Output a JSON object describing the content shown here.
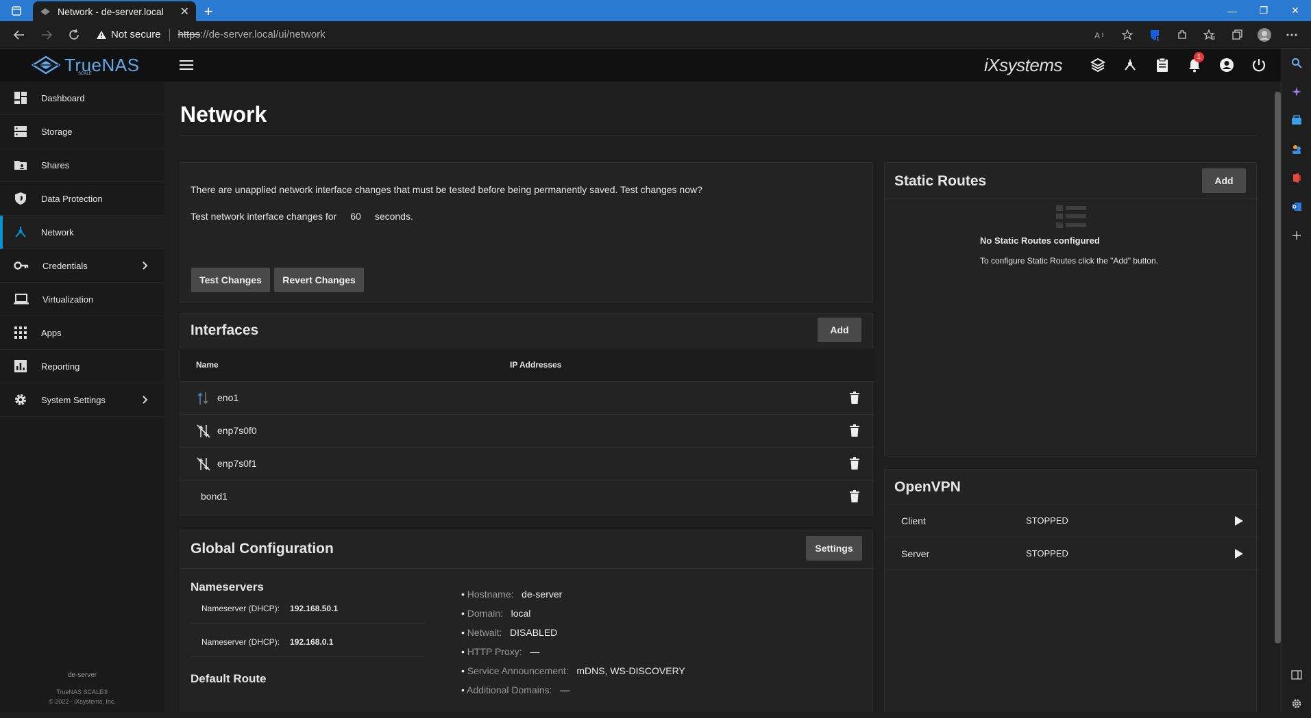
{
  "browser": {
    "tab_title": "Network - de-server.local",
    "not_secure": "Not secure",
    "url_scheme": "https",
    "url_rest": "://de-server.local/ui/network"
  },
  "topbar": {
    "brand": "TrueNAS",
    "brand_sub": "SCALE",
    "vendor": "iXsystems",
    "alert_count": "1"
  },
  "sidebar": {
    "items": [
      {
        "label": "Dashboard"
      },
      {
        "label": "Storage"
      },
      {
        "label": "Shares"
      },
      {
        "label": "Data Protection"
      },
      {
        "label": "Network"
      },
      {
        "label": "Credentials"
      },
      {
        "label": "Virtualization"
      },
      {
        "label": "Apps"
      },
      {
        "label": "Reporting"
      },
      {
        "label": "System Settings"
      }
    ],
    "hostname": "de-server",
    "product": "TrueNAS SCALE®",
    "copyright": "© 2022 - iXsystems, Inc."
  },
  "page": {
    "title": "Network"
  },
  "pending": {
    "message": "There are unapplied network interface changes that must be tested before being permanently saved. Test changes now?",
    "test_prefix": "Test network interface changes for",
    "seconds_value": "60",
    "test_suffix": "seconds.",
    "test_button": "Test Changes",
    "revert_button": "Revert Changes"
  },
  "interfaces": {
    "title": "Interfaces",
    "add_button": "Add",
    "col_name": "Name",
    "col_ip": "IP Addresses",
    "rows": [
      {
        "name": "eno1"
      },
      {
        "name": "enp7s0f0"
      },
      {
        "name": "enp7s0f1"
      },
      {
        "name": "bond1"
      }
    ]
  },
  "global": {
    "title": "Global Configuration",
    "settings_button": "Settings",
    "nameservers_title": "Nameservers",
    "nameservers": [
      {
        "label": "Nameserver (DHCP):",
        "value": "192.168.50.1"
      },
      {
        "label": "Nameserver (DHCP):",
        "value": "192.168.0.1"
      }
    ],
    "default_route_title": "Default Route",
    "info": [
      {
        "label": "Hostname:",
        "value": "de-server"
      },
      {
        "label": "Domain:",
        "value": "local"
      },
      {
        "label": "Netwait:",
        "value": "DISABLED"
      },
      {
        "label": "HTTP Proxy:",
        "value": "—"
      },
      {
        "label": "Service Announcement:",
        "value": "mDNS, WS-DISCOVERY"
      },
      {
        "label": "Additional Domains:",
        "value": "—"
      }
    ]
  },
  "static_routes": {
    "title": "Static Routes",
    "add_button": "Add",
    "empty_title": "No Static Routes configured",
    "empty_text": "To configure Static Routes click the \"Add\" button."
  },
  "openvpn": {
    "title": "OpenVPN",
    "rows": [
      {
        "name": "Client",
        "status": "STOPPED"
      },
      {
        "name": "Server",
        "status": "STOPPED"
      }
    ]
  },
  "colors": {
    "accent": "#0095d5",
    "tabbar": "#2b7ad1",
    "brand": "#61a8e8"
  }
}
